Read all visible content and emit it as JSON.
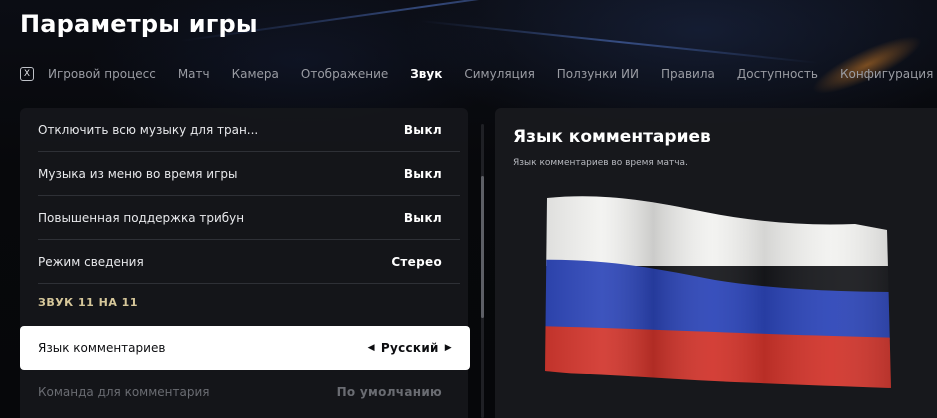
{
  "header": {
    "title": "Параметры игры"
  },
  "tabs": {
    "key_hint": "X",
    "items": [
      {
        "label": "Игровой процесс",
        "active": false
      },
      {
        "label": "Матч",
        "active": false
      },
      {
        "label": "Камера",
        "active": false
      },
      {
        "label": "Отображение",
        "active": false
      },
      {
        "label": "Звук",
        "active": true
      },
      {
        "label": "Симуляция",
        "active": false
      },
      {
        "label": "Ползунки ИИ",
        "active": false
      },
      {
        "label": "Правила",
        "active": false
      },
      {
        "label": "Доступность",
        "active": false
      },
      {
        "label": "Конфигурация экрана",
        "active": false
      }
    ]
  },
  "settings": {
    "rows": [
      {
        "label": "Отключить всю музыку для тран...",
        "value": "Выкл"
      },
      {
        "label": "Музыка из меню во время игры",
        "value": "Выкл"
      },
      {
        "label": "Повышенная поддержка трибун",
        "value": "Выкл"
      },
      {
        "label": "Режим сведения",
        "value": "Стерео"
      }
    ],
    "section_header": "ЗВУК 11 НА 11",
    "selected_row": {
      "label": "Язык комментариев",
      "value": "Русский",
      "arrow_left": "◀",
      "arrow_right": "▶"
    },
    "dim_row": {
      "label": "Команда для комментария",
      "value": "По умолчанию"
    }
  },
  "detail": {
    "title": "Язык комментариев",
    "description": "Язык комментариев во время матча.",
    "image_icon": "russian-flag",
    "flag_colors": {
      "white": "#f2f2f0",
      "blue": "#2c45b8",
      "red": "#d1342b"
    }
  }
}
